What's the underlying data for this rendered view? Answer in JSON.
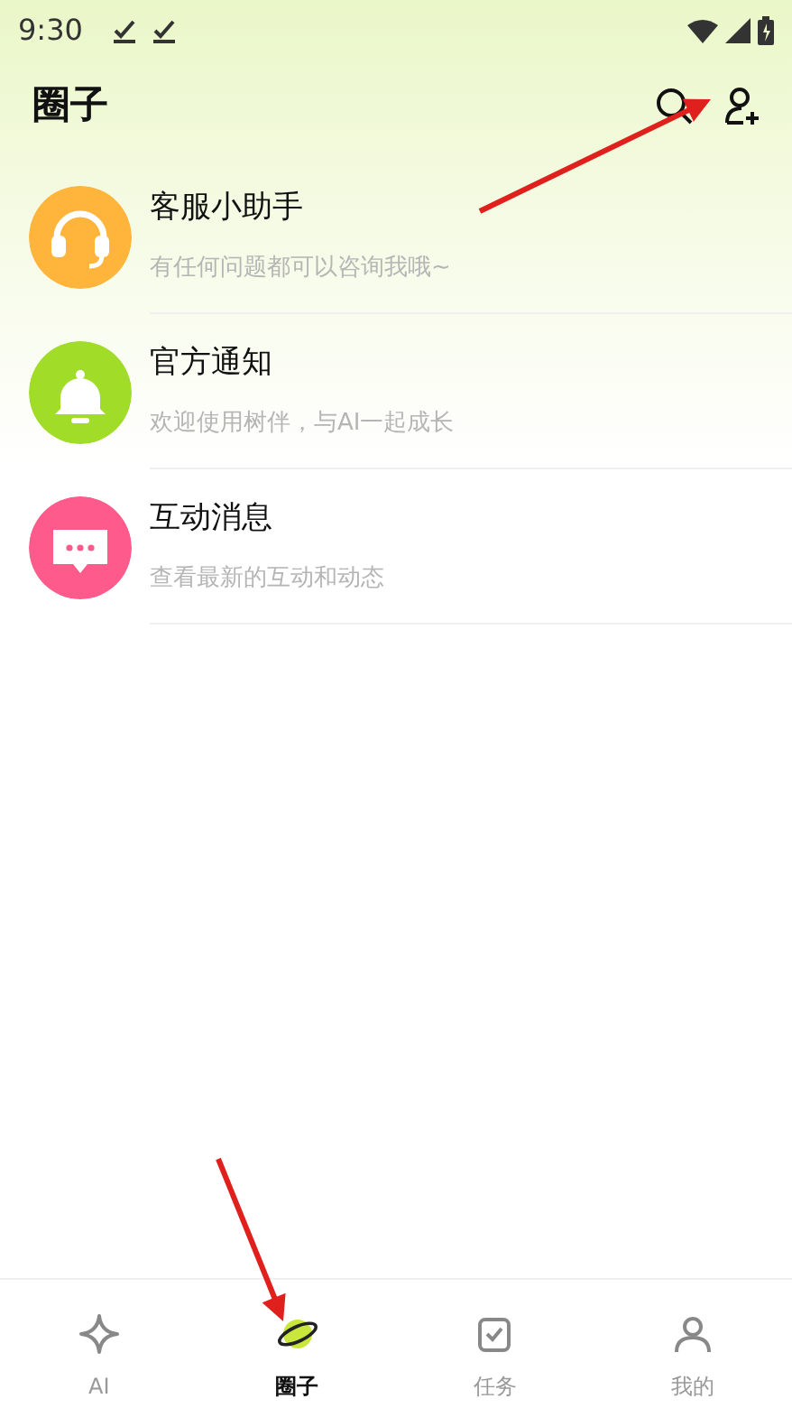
{
  "status_bar": {
    "time": "9:30"
  },
  "header": {
    "title": "圈子"
  },
  "conversations": [
    {
      "kind": "headset",
      "color": "#ffb43c",
      "name": "客服小助手",
      "preview": "有任何问题都可以咨询我哦~"
    },
    {
      "kind": "bell",
      "color": "#a0dc28",
      "name": "官方通知",
      "preview": "欢迎使用树伴，与AI一起成长"
    },
    {
      "kind": "chat",
      "color": "#ff5a8c",
      "name": "互动消息",
      "preview": "查看最新的互动和动态"
    }
  ],
  "tabs": [
    {
      "kind": "sparkle",
      "label": "AI",
      "selected": false
    },
    {
      "kind": "planet",
      "label": "圈子",
      "selected": true
    },
    {
      "kind": "task",
      "label": "任务",
      "selected": false
    },
    {
      "kind": "person",
      "label": "我的",
      "selected": false
    }
  ],
  "annotations": [
    {
      "kind": "arrow"
    },
    {
      "kind": "arrow"
    }
  ]
}
